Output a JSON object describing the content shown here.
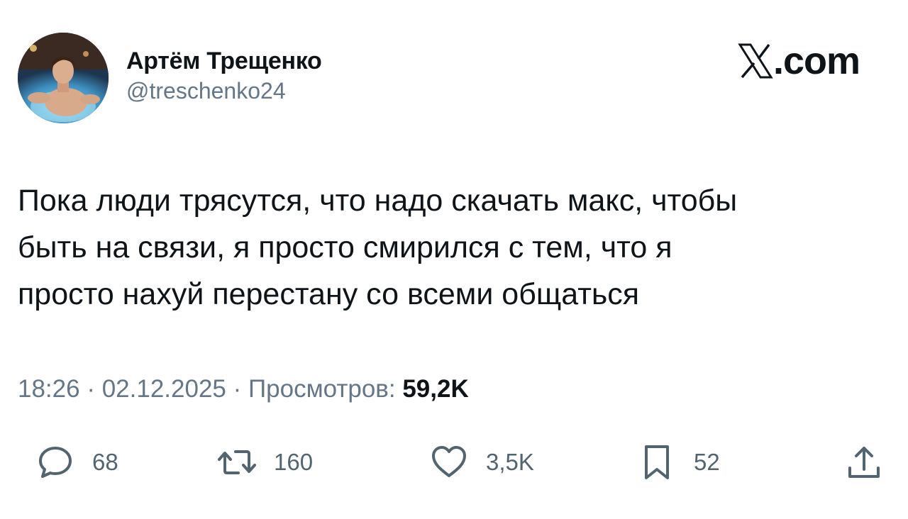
{
  "author": {
    "name": "Артём Трещенко",
    "handle": "@treschenko24"
  },
  "brand": {
    "suffix": ".com"
  },
  "tweet": {
    "text": "Пока люди трясутся, что надо скачать макс, чтобы\nбыть на связи, я просто смирился с тем, что я\nпросто нахуй перестану со всеми общаться"
  },
  "meta": {
    "time": "18:26",
    "separator": " · ",
    "date": "02.12.2025",
    "views_label": "Просмотров:",
    "views_value": "59,2K"
  },
  "actions": {
    "reply_count": "68",
    "retweet_count": "160",
    "like_count": "3,5K",
    "bookmark_count": "52"
  },
  "icons": {
    "reply": "speech-bubble-icon",
    "retweet": "retweet-arrows-icon",
    "like": "heart-icon",
    "bookmark": "bookmark-icon",
    "share": "share-upload-icon",
    "brand": "x-logo-icon"
  },
  "colors": {
    "text": "#0f1419",
    "secondary": "#536471",
    "background": "#ffffff"
  }
}
